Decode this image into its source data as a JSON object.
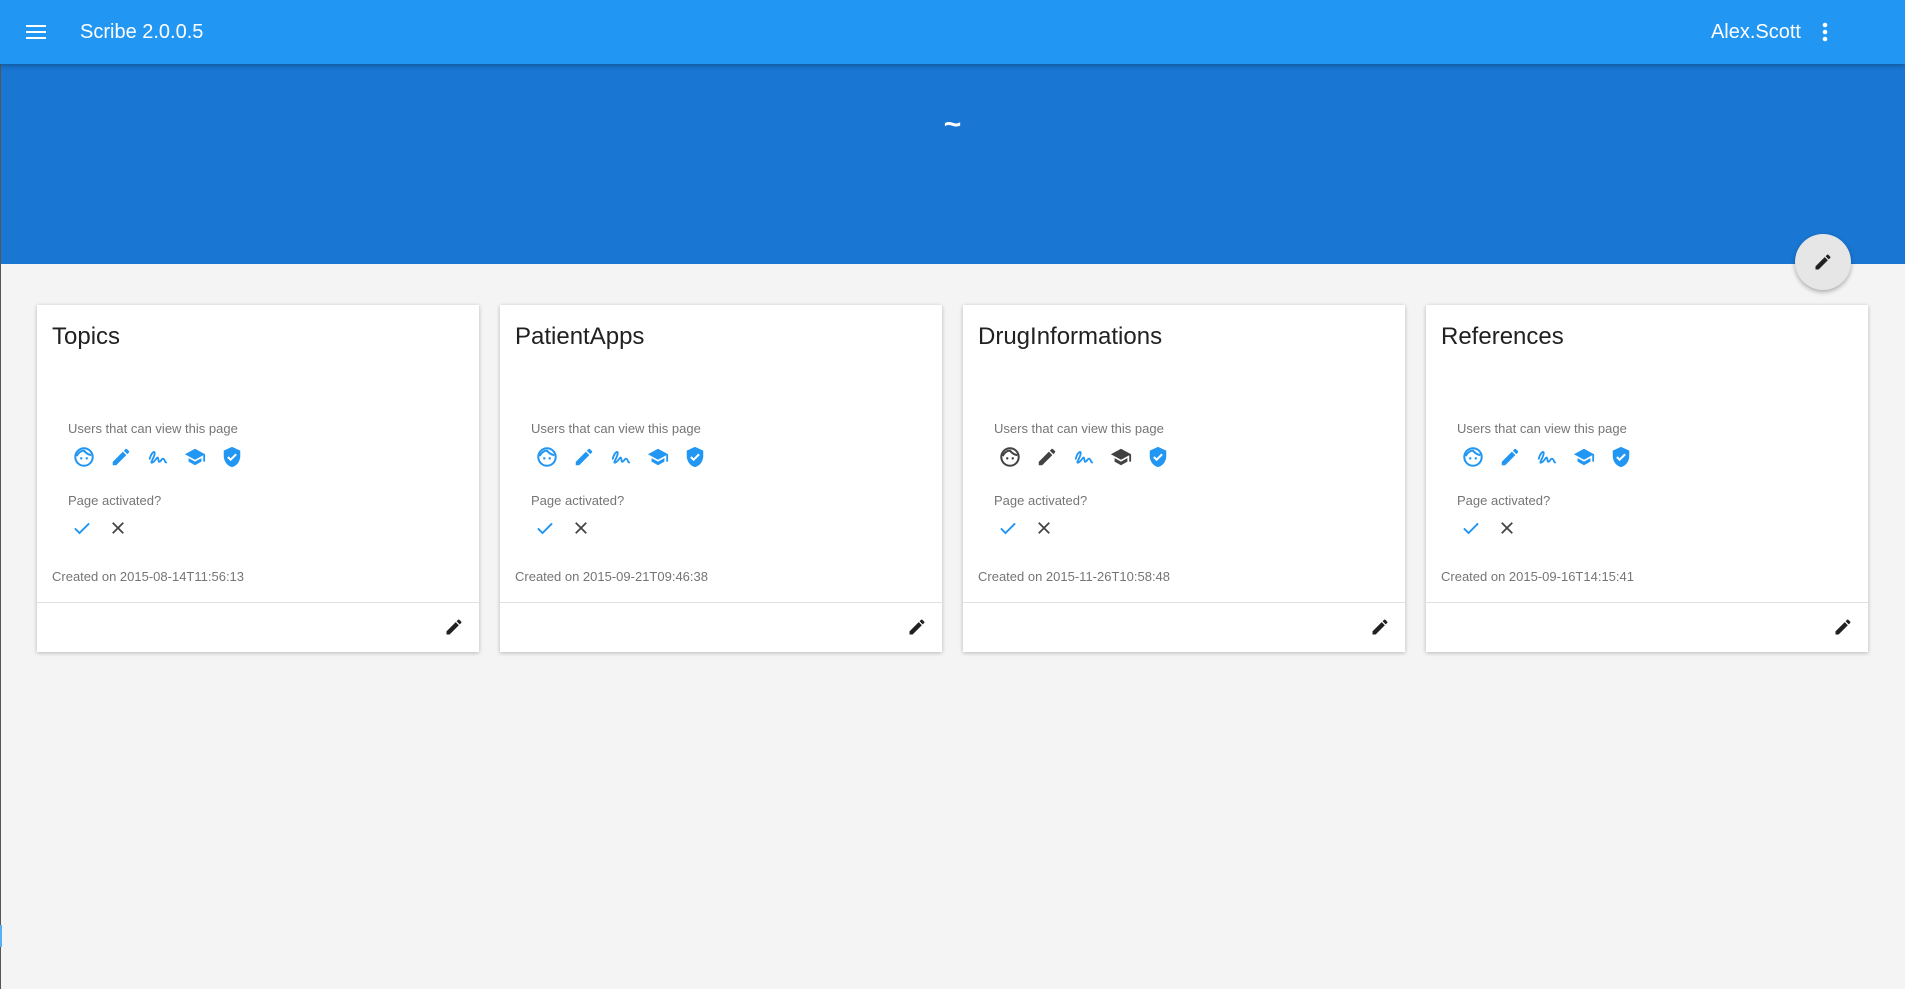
{
  "app": {
    "title": "Scribe 2.0.0.5",
    "user": "Alex.Scott",
    "menu_icon": "menu-icon",
    "more_icon": "more-vert-icon"
  },
  "hero": {
    "title": "~"
  },
  "colors": {
    "appbar": "#2196f3",
    "hero": "#1976d2",
    "accent": "#2196f3",
    "inactive": "#424242"
  },
  "cards": [
    {
      "title": "Topics",
      "users_label": "Users that can view this page",
      "roles": [
        "face-icon",
        "pencil-icon",
        "signature-icon",
        "school-icon",
        "shield-check-icon"
      ],
      "roles_active": [
        true,
        true,
        true,
        true,
        true
      ],
      "activated_label": "Page activated?",
      "created": "Created on 2015-08-14T11:56:13"
    },
    {
      "title": "PatientApps",
      "users_label": "Users that can view this page",
      "roles": [
        "face-icon",
        "pencil-icon",
        "signature-icon",
        "school-icon",
        "shield-check-icon"
      ],
      "roles_active": [
        true,
        true,
        true,
        true,
        true
      ],
      "activated_label": "Page activated?",
      "created": "Created on 2015-09-21T09:46:38"
    },
    {
      "title": "DrugInformations",
      "users_label": "Users that can view this page",
      "roles": [
        "face-icon",
        "pencil-icon",
        "signature-icon",
        "school-icon",
        "shield-check-icon"
      ],
      "roles_active": [
        false,
        false,
        true,
        false,
        true
      ],
      "activated_label": "Page activated?",
      "created": "Created on 2015-11-26T10:58:48"
    },
    {
      "title": "References",
      "users_label": "Users that can view this page",
      "roles": [
        "face-icon",
        "pencil-icon",
        "signature-icon",
        "school-icon",
        "shield-check-icon"
      ],
      "roles_active": [
        true,
        true,
        true,
        true,
        true
      ],
      "activated_label": "Page activated?",
      "created": "Created on 2015-09-16T14:15:41"
    }
  ]
}
